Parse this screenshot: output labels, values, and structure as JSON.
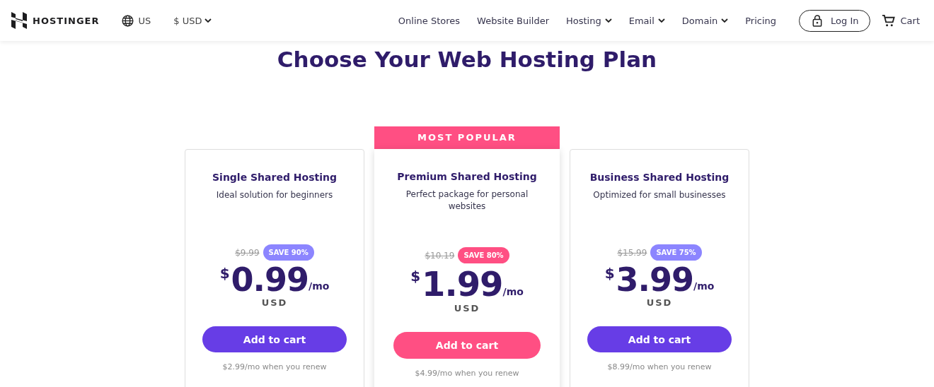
{
  "header": {
    "brand": "HOSTINGER",
    "region": "US",
    "currency": "$ USD",
    "nav": [
      {
        "label": "Online Stores",
        "dropdown": false
      },
      {
        "label": "Website Builder",
        "dropdown": false
      },
      {
        "label": "Hosting",
        "dropdown": true
      },
      {
        "label": "Email",
        "dropdown": true
      },
      {
        "label": "Domain",
        "dropdown": true
      },
      {
        "label": "Pricing",
        "dropdown": false
      }
    ],
    "login": "Log In",
    "cart": "Cart"
  },
  "title": "Choose Your Web Hosting Plan",
  "plans": [
    {
      "name": "Single Shared Hosting",
      "description": "Ideal solution for beginners",
      "featured": false,
      "old_price": "$9.99",
      "save": "SAVE 90%",
      "currency_symbol": "$",
      "price": "0.99",
      "period": "/mo",
      "currency": "USD",
      "button": "Add to cart",
      "renew": "$2.99/mo when you renew"
    },
    {
      "name": "Premium Shared Hosting",
      "description": "Perfect package for personal websites",
      "featured": true,
      "banner": "MOST POPULAR",
      "old_price": "$10.19",
      "save": "SAVE 80%",
      "currency_symbol": "$",
      "price": "1.99",
      "period": "/mo",
      "currency": "USD",
      "button": "Add to cart",
      "renew": "$4.99/mo when you renew"
    },
    {
      "name": "Business Shared Hosting",
      "description": "Optimized for small businesses",
      "featured": false,
      "old_price": "$15.99",
      "save": "SAVE 75%",
      "currency_symbol": "$",
      "price": "3.99",
      "period": "/mo",
      "currency": "USD",
      "button": "Add to cart",
      "renew": "$8.99/mo when you renew"
    }
  ]
}
